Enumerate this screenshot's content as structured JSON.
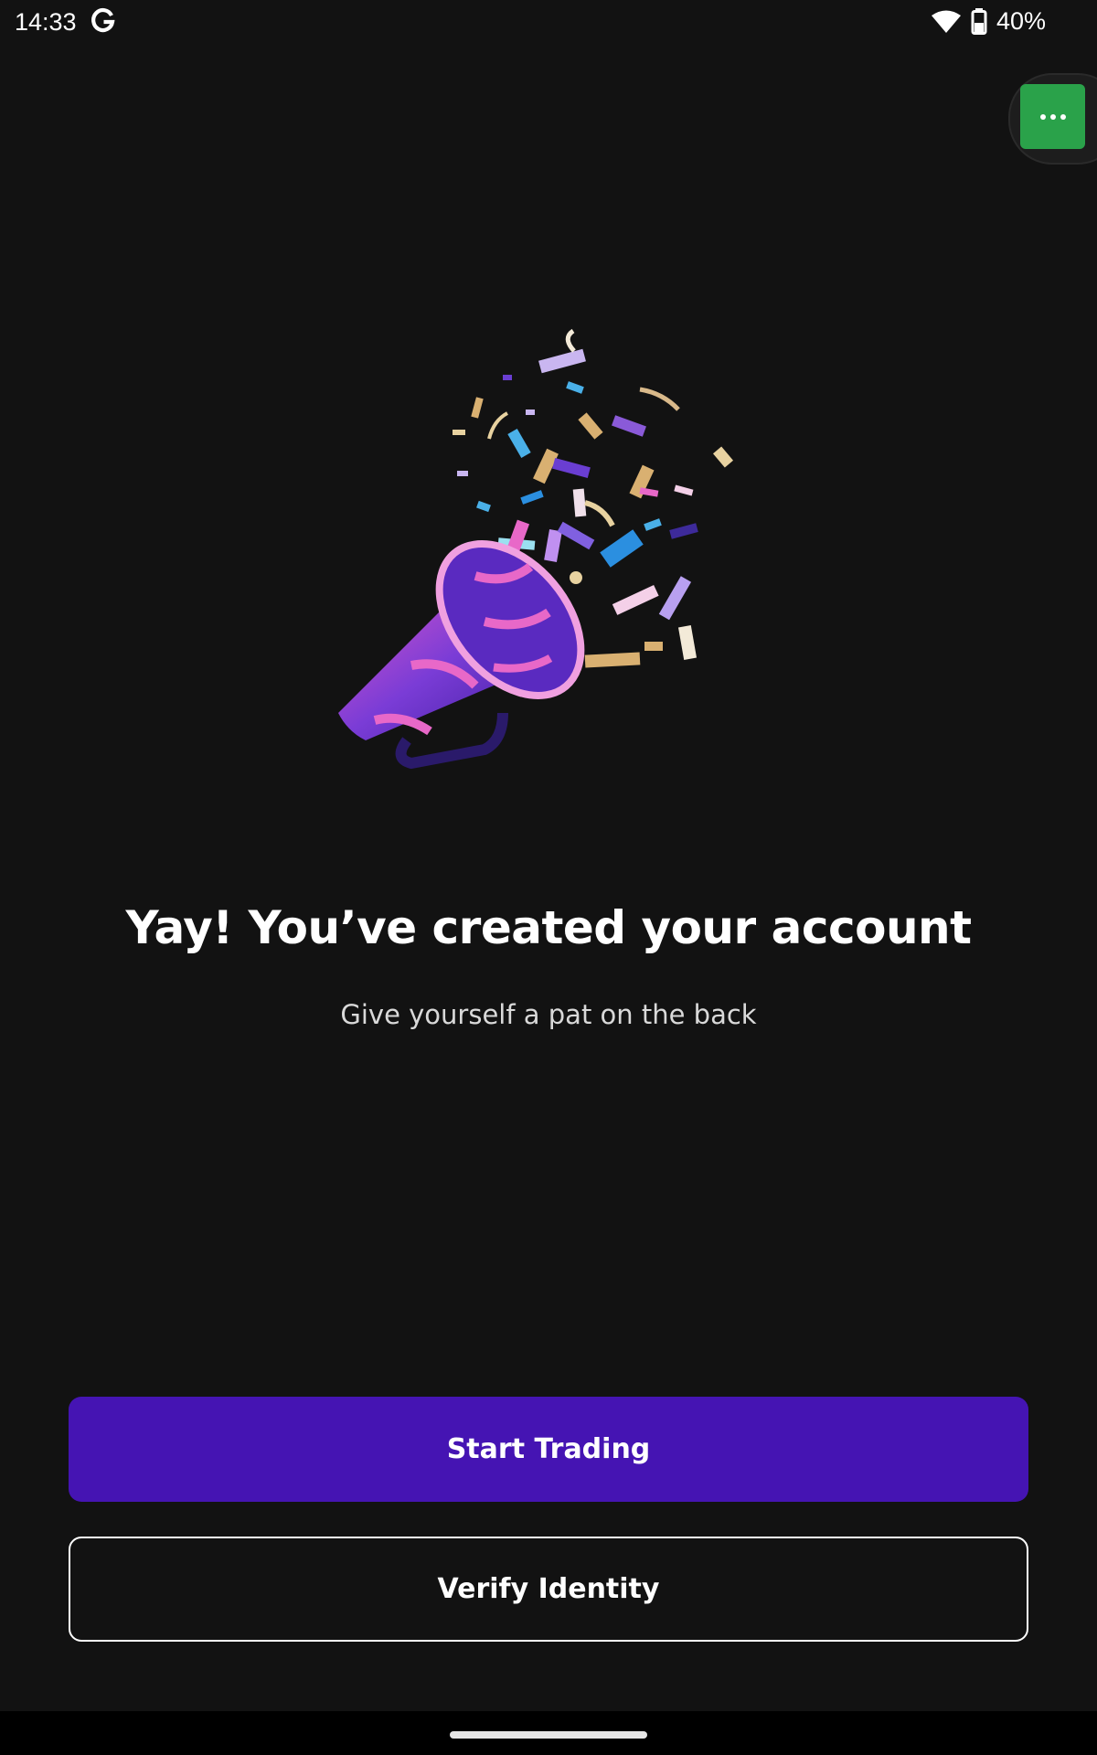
{
  "status_bar": {
    "time": "14:33",
    "notification_icons": [
      "google-g-icon"
    ],
    "system_icons": [
      "wifi-icon",
      "battery-icon"
    ],
    "battery_percent": "40%"
  },
  "overlay": {
    "more_button_icon": "more-horizontal-icon",
    "more_button_color": "#2aa24a"
  },
  "illustration": {
    "icon": "party-popper-megaphone-confetti"
  },
  "main": {
    "headline": "Yay! You’ve created your account",
    "subhead": "Give yourself a pat on the back"
  },
  "actions": {
    "primary_label": "Start Trading",
    "primary_color": "#4514b3",
    "secondary_label": "Verify Identity"
  },
  "colors": {
    "background": "#121212",
    "text": "#ffffff"
  }
}
